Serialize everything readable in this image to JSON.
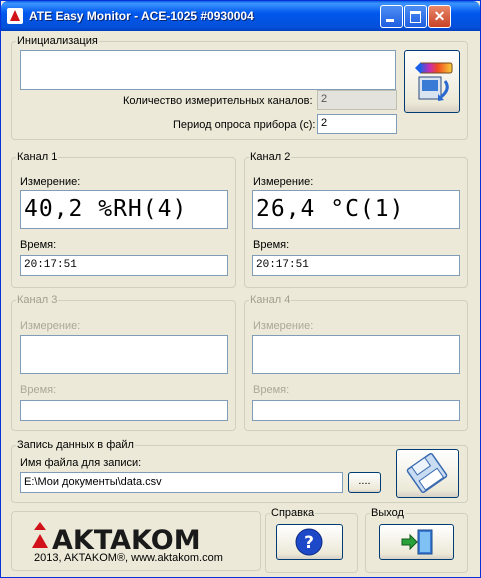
{
  "window": {
    "title": "ATE Easy Monitor - ACE-1025 #0930004"
  },
  "init": {
    "legend": "Инициализация",
    "status_text": "",
    "channels_count_label": "Количество измерительных каналов:",
    "channels_count": "2",
    "poll_period_label": "Период опроса прибора (с):",
    "poll_period": "2"
  },
  "channels": [
    {
      "legend": "Канал 1",
      "measure_label": "Измерение:",
      "measure_value": "40,2 %RH(4)",
      "time_label": "Время:",
      "time_value": "20:17:51"
    },
    {
      "legend": "Канал 2",
      "measure_label": "Измерение:",
      "measure_value": "26,4 °C(1)",
      "time_label": "Время:",
      "time_value": "20:17:51"
    },
    {
      "legend": "Канал 3",
      "measure_label": "Измерение:",
      "measure_value": "",
      "time_label": "Время:",
      "time_value": ""
    },
    {
      "legend": "Канал 4",
      "measure_label": "Измерение:",
      "measure_value": "",
      "time_label": "Время:",
      "time_value": ""
    }
  ],
  "file_section": {
    "legend": "Запись данных в файл",
    "filename_label": "Имя файла для записи:",
    "filename": "E:\\Мои документы\\data.csv",
    "browse_label": "...."
  },
  "brand": {
    "logo_text": "AKTAKOM",
    "copyright": "2013, AKTAKOM®, www.aktakom.com"
  },
  "help": {
    "legend": "Справка"
  },
  "exit": {
    "legend": "Выход"
  },
  "colors": {
    "titlebar": "#0058ee",
    "window_bg": "#ece9d8",
    "logo": "#d1121b",
    "help_button": "#1d48c8"
  },
  "icons": [
    "app-icon",
    "connect-icon",
    "save-disk-icon",
    "help-question-icon",
    "exit-door-icon"
  ]
}
